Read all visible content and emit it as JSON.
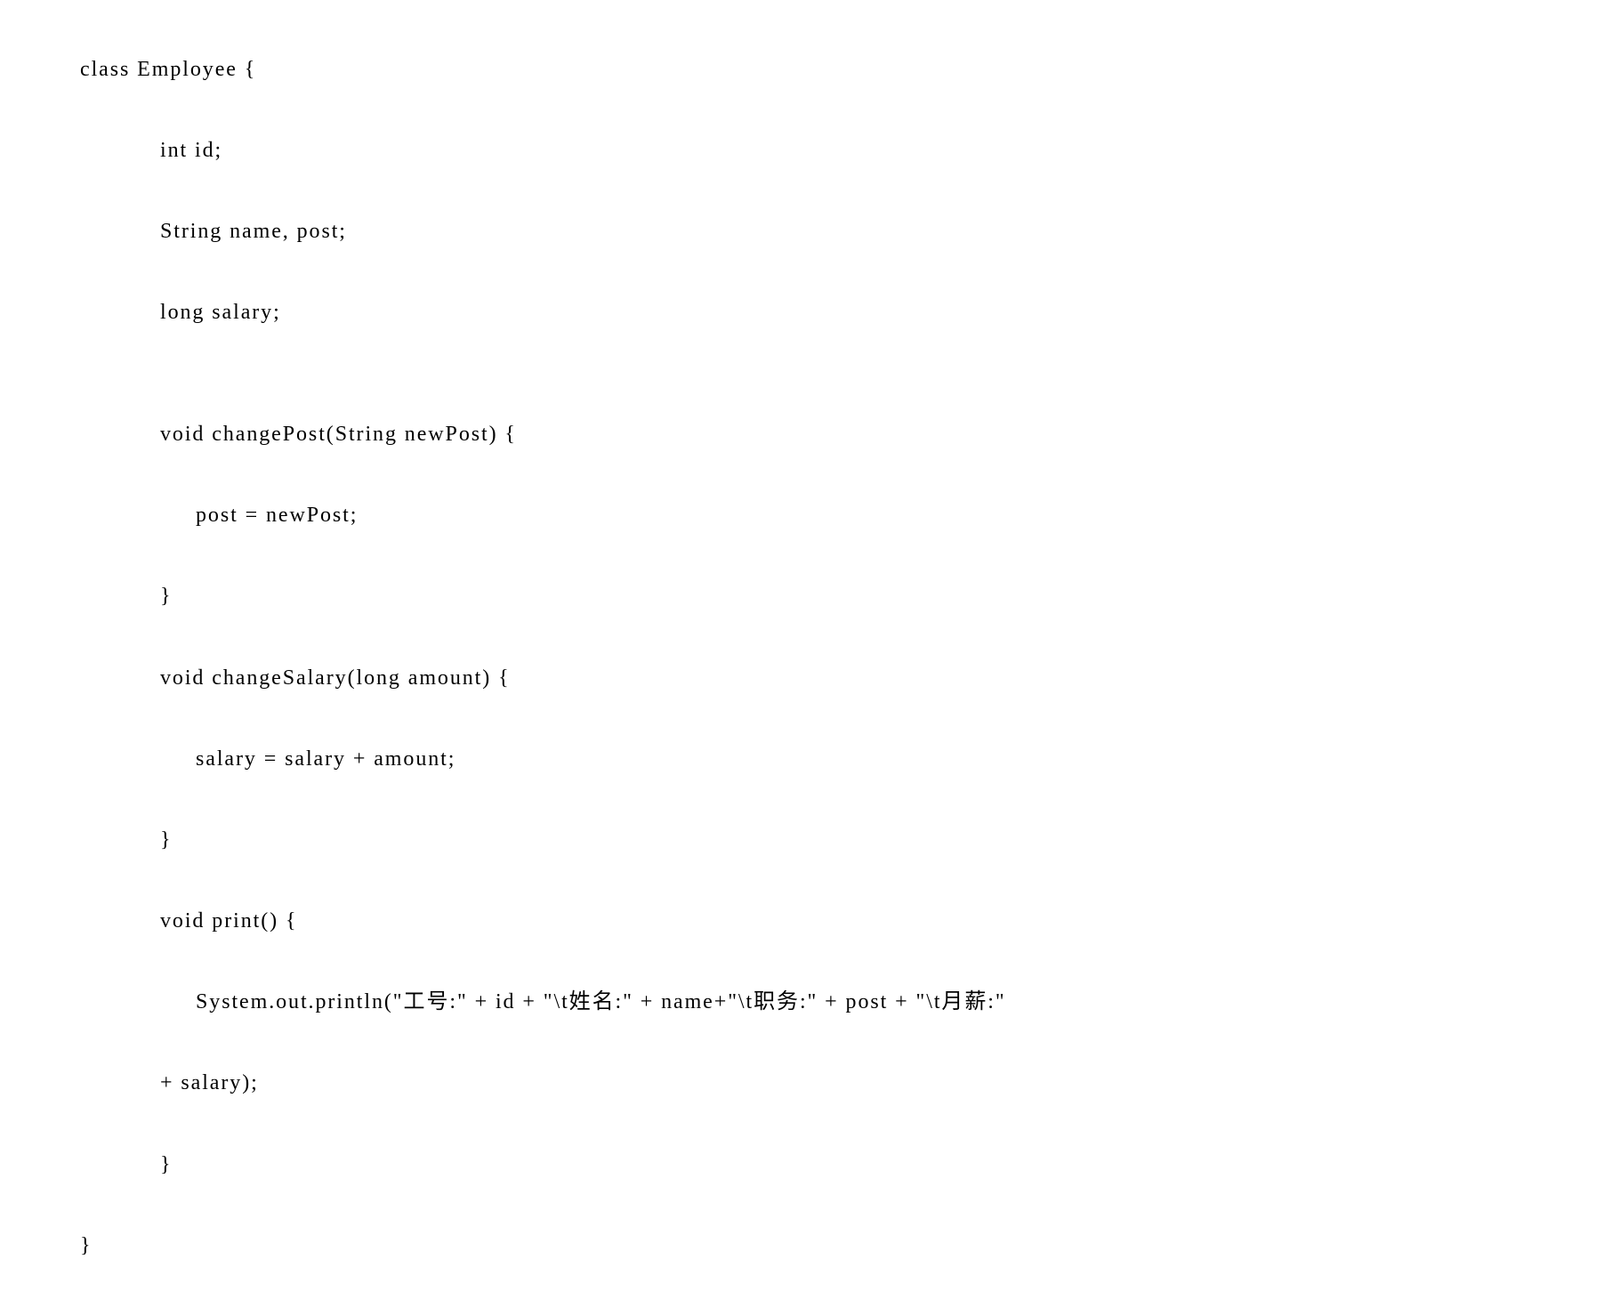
{
  "code": {
    "line1": "class Employee {",
    "line2": "int id;",
    "line3": "String name, post;",
    "line4": "long salary;",
    "line5": "",
    "line6": "void changePost(String newPost) {",
    "line7": "post = newPost;",
    "line8": "}",
    "line9": "void changeSalary(long amount) {",
    "line10": "salary = salary + amount;",
    "line11": "}",
    "line12": "void print() {",
    "line13": "System.out.println(\"工号:\" + id + \"\\t姓名:\" + name+\"\\t职务:\" + post + \"\\t月薪:\"",
    "line14": "+ salary);",
    "line15": "}",
    "line16": "}"
  }
}
